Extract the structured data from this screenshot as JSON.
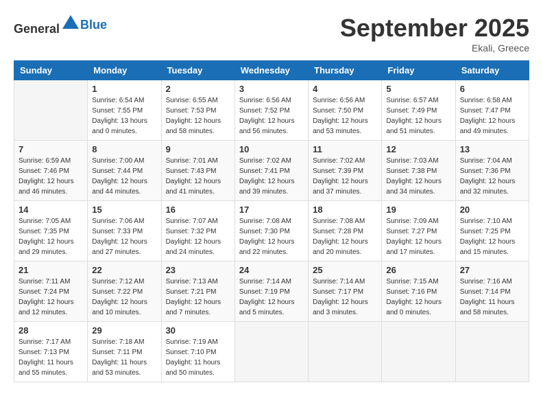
{
  "header": {
    "logo_general": "General",
    "logo_blue": "Blue",
    "month_title": "September 2025",
    "location": "Ekali, Greece"
  },
  "weekdays": [
    "Sunday",
    "Monday",
    "Tuesday",
    "Wednesday",
    "Thursday",
    "Friday",
    "Saturday"
  ],
  "weeks": [
    [
      {
        "day": "",
        "info": ""
      },
      {
        "day": "1",
        "info": "Sunrise: 6:54 AM\nSunset: 7:55 PM\nDaylight: 13 hours\nand 0 minutes."
      },
      {
        "day": "2",
        "info": "Sunrise: 6:55 AM\nSunset: 7:53 PM\nDaylight: 12 hours\nand 58 minutes."
      },
      {
        "day": "3",
        "info": "Sunrise: 6:56 AM\nSunset: 7:52 PM\nDaylight: 12 hours\nand 56 minutes."
      },
      {
        "day": "4",
        "info": "Sunrise: 6:56 AM\nSunset: 7:50 PM\nDaylight: 12 hours\nand 53 minutes."
      },
      {
        "day": "5",
        "info": "Sunrise: 6:57 AM\nSunset: 7:49 PM\nDaylight: 12 hours\nand 51 minutes."
      },
      {
        "day": "6",
        "info": "Sunrise: 6:58 AM\nSunset: 7:47 PM\nDaylight: 12 hours\nand 49 minutes."
      }
    ],
    [
      {
        "day": "7",
        "info": "Sunrise: 6:59 AM\nSunset: 7:46 PM\nDaylight: 12 hours\nand 46 minutes."
      },
      {
        "day": "8",
        "info": "Sunrise: 7:00 AM\nSunset: 7:44 PM\nDaylight: 12 hours\nand 44 minutes."
      },
      {
        "day": "9",
        "info": "Sunrise: 7:01 AM\nSunset: 7:43 PM\nDaylight: 12 hours\nand 41 minutes."
      },
      {
        "day": "10",
        "info": "Sunrise: 7:02 AM\nSunset: 7:41 PM\nDaylight: 12 hours\nand 39 minutes."
      },
      {
        "day": "11",
        "info": "Sunrise: 7:02 AM\nSunset: 7:39 PM\nDaylight: 12 hours\nand 37 minutes."
      },
      {
        "day": "12",
        "info": "Sunrise: 7:03 AM\nSunset: 7:38 PM\nDaylight: 12 hours\nand 34 minutes."
      },
      {
        "day": "13",
        "info": "Sunrise: 7:04 AM\nSunset: 7:36 PM\nDaylight: 12 hours\nand 32 minutes."
      }
    ],
    [
      {
        "day": "14",
        "info": "Sunrise: 7:05 AM\nSunset: 7:35 PM\nDaylight: 12 hours\nand 29 minutes."
      },
      {
        "day": "15",
        "info": "Sunrise: 7:06 AM\nSunset: 7:33 PM\nDaylight: 12 hours\nand 27 minutes."
      },
      {
        "day": "16",
        "info": "Sunrise: 7:07 AM\nSunset: 7:32 PM\nDaylight: 12 hours\nand 24 minutes."
      },
      {
        "day": "17",
        "info": "Sunrise: 7:08 AM\nSunset: 7:30 PM\nDaylight: 12 hours\nand 22 minutes."
      },
      {
        "day": "18",
        "info": "Sunrise: 7:08 AM\nSunset: 7:28 PM\nDaylight: 12 hours\nand 20 minutes."
      },
      {
        "day": "19",
        "info": "Sunrise: 7:09 AM\nSunset: 7:27 PM\nDaylight: 12 hours\nand 17 minutes."
      },
      {
        "day": "20",
        "info": "Sunrise: 7:10 AM\nSunset: 7:25 PM\nDaylight: 12 hours\nand 15 minutes."
      }
    ],
    [
      {
        "day": "21",
        "info": "Sunrise: 7:11 AM\nSunset: 7:24 PM\nDaylight: 12 hours\nand 12 minutes."
      },
      {
        "day": "22",
        "info": "Sunrise: 7:12 AM\nSunset: 7:22 PM\nDaylight: 12 hours\nand 10 minutes."
      },
      {
        "day": "23",
        "info": "Sunrise: 7:13 AM\nSunset: 7:21 PM\nDaylight: 12 hours\nand 7 minutes."
      },
      {
        "day": "24",
        "info": "Sunrise: 7:14 AM\nSunset: 7:19 PM\nDaylight: 12 hours\nand 5 minutes."
      },
      {
        "day": "25",
        "info": "Sunrise: 7:14 AM\nSunset: 7:17 PM\nDaylight: 12 hours\nand 3 minutes."
      },
      {
        "day": "26",
        "info": "Sunrise: 7:15 AM\nSunset: 7:16 PM\nDaylight: 12 hours\nand 0 minutes."
      },
      {
        "day": "27",
        "info": "Sunrise: 7:16 AM\nSunset: 7:14 PM\nDaylight: 11 hours\nand 58 minutes."
      }
    ],
    [
      {
        "day": "28",
        "info": "Sunrise: 7:17 AM\nSunset: 7:13 PM\nDaylight: 11 hours\nand 55 minutes."
      },
      {
        "day": "29",
        "info": "Sunrise: 7:18 AM\nSunset: 7:11 PM\nDaylight: 11 hours\nand 53 minutes."
      },
      {
        "day": "30",
        "info": "Sunrise: 7:19 AM\nSunset: 7:10 PM\nDaylight: 11 hours\nand 50 minutes."
      },
      {
        "day": "",
        "info": ""
      },
      {
        "day": "",
        "info": ""
      },
      {
        "day": "",
        "info": ""
      },
      {
        "day": "",
        "info": ""
      }
    ]
  ]
}
